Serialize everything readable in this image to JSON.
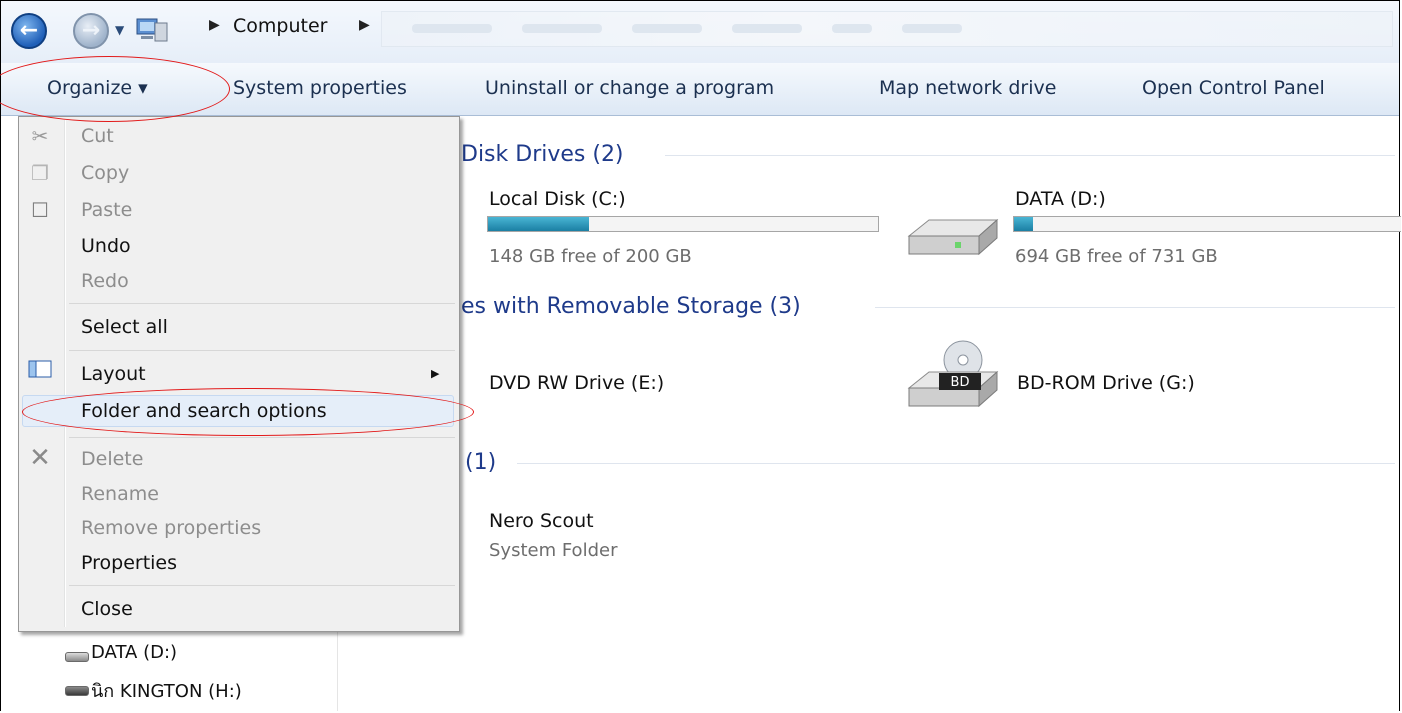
{
  "address_bar": {
    "breadcrumb": "Computer"
  },
  "toolbar": {
    "organize": "Organize ▾",
    "system_properties": "System properties",
    "uninstall": "Uninstall or change a program",
    "map_drive": "Map network drive",
    "control_panel": "Open Control Panel"
  },
  "content": {
    "hdd_group": "Disk Drives (2)",
    "removable_group": "es with Removable Storage (3)",
    "other_group": "(1)",
    "drives": [
      {
        "name": "Local Disk (C:)",
        "free_text": "148 GB free of 200 GB",
        "used_fraction": 0.26
      },
      {
        "name": "DATA (D:)",
        "free_text": "694 GB free of 731 GB",
        "used_fraction": 0.05
      }
    ],
    "removable": [
      {
        "name": "DVD RW Drive (E:)"
      },
      {
        "name": "BD-ROM Drive (G:)",
        "badge": "BD"
      }
    ],
    "other": [
      {
        "name": "Nero Scout",
        "sub": "System Folder"
      }
    ]
  },
  "nav_pane": {
    "items": [
      "DATA (D:)",
      "นิก KINGTON (H:)"
    ]
  },
  "organize_menu": {
    "items": [
      {
        "label": "Cut",
        "enabled": false,
        "icon": "scissors-icon"
      },
      {
        "label": "Copy",
        "enabled": false,
        "icon": "copy-icon"
      },
      {
        "label": "Paste",
        "enabled": false,
        "icon": "paste-icon"
      },
      {
        "label": "Undo",
        "enabled": true
      },
      {
        "label": "Redo",
        "enabled": false
      },
      {
        "label": "Select all",
        "enabled": true
      },
      {
        "label": "Layout",
        "enabled": true,
        "icon": "layout-icon",
        "submenu": true
      },
      {
        "label": "Folder and search options",
        "enabled": true,
        "highlighted": true
      },
      {
        "label": "Delete",
        "enabled": false,
        "icon": "delete-icon"
      },
      {
        "label": "Rename",
        "enabled": false
      },
      {
        "label": "Remove properties",
        "enabled": false
      },
      {
        "label": "Properties",
        "enabled": true
      },
      {
        "label": "Close",
        "enabled": true
      }
    ]
  },
  "colors": {
    "annotation_red": "#e21b1b",
    "group_header": "#1e3a8a",
    "capacity_fill": "#1b7fa3"
  }
}
